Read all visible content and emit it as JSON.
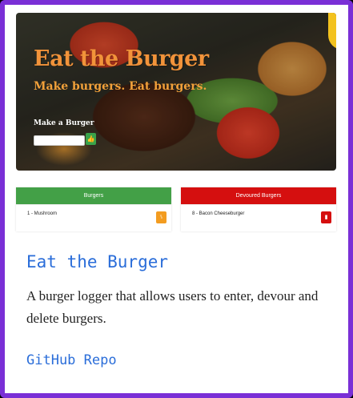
{
  "preview": {
    "hero_title": "Eat the Burger",
    "hero_subtitle": "Make burgers. Eat burgers.",
    "form_label": "Make a Burger",
    "input_value": "",
    "submit_icon": "thumbs-up-icon",
    "panels": {
      "burgers": {
        "header": "Burgers",
        "items": [
          {
            "label": "1 - Mushroom",
            "action_icon": "utensils-icon"
          }
        ]
      },
      "devoured": {
        "header": "Devoured Burgers",
        "items": [
          {
            "label": "8 - Bacon Cheeseburger",
            "action_icon": "trash-icon"
          }
        ]
      }
    }
  },
  "card": {
    "title": "Eat the Burger",
    "description": "A burger logger that allows users to enter, devour and delete burgers.",
    "link_label": "GitHub Repo"
  },
  "colors": {
    "border": "#7a2fd6",
    "link": "#2a6dd9",
    "green": "#43a047",
    "red": "#d50f0f",
    "orange": "#f39c20"
  }
}
